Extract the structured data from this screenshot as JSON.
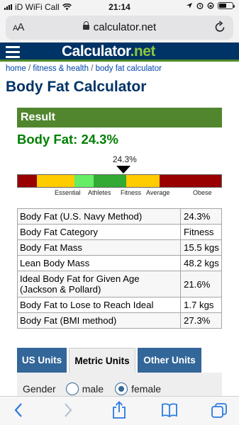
{
  "status": {
    "carrier": "iD WiFi Call",
    "time": "21:14"
  },
  "browser": {
    "aa_small": "A",
    "aa_big": "A",
    "url": "calculator.net"
  },
  "site": {
    "logo_main": "Calculator",
    "logo_dot": ".",
    "logo_tld": "net"
  },
  "breadcrumb": {
    "home": "home",
    "sep1": " / ",
    "fitness": "fitness & health",
    "sep2": " / ",
    "current": "body fat calculator"
  },
  "page_title": "Body Fat Calculator",
  "result": {
    "header": "Result",
    "headline": "Body Fat: 24.3%",
    "gauge": {
      "value_label": "24.3%",
      "value": 24.3,
      "min": 2,
      "max": 45,
      "segments": [
        {
          "label": "Essential",
          "from": 2,
          "to": 6,
          "color": "#990000"
        },
        {
          "label": "Athletes",
          "from": 6,
          "to": 14,
          "color": "#ffcc00"
        },
        {
          "label": "Fitness",
          "from": 14,
          "to": 18,
          "color": "#66ee66"
        },
        {
          "label": "Average",
          "from": 18,
          "to": 25,
          "color": "#33aa33"
        },
        {
          "label": "Obese",
          "from": 25,
          "to": 32,
          "color": "#ffcc00"
        },
        {
          "label": "",
          "from": 32,
          "to": 45,
          "color": "#990000"
        }
      ],
      "labels": [
        "Essential",
        "Athletes",
        "Fitness",
        "Average",
        "Obese"
      ]
    },
    "rows": [
      {
        "label": "Body Fat (U.S. Navy Method)",
        "value": "24.3%"
      },
      {
        "label": "Body Fat Category",
        "value": "Fitness"
      },
      {
        "label": "Body Fat Mass",
        "value": "15.5 kgs"
      },
      {
        "label": "Lean Body Mass",
        "value": "48.2 kgs"
      },
      {
        "label": "Ideal Body Fat for Given Age (Jackson & Pollard)",
        "value": "21.6%"
      },
      {
        "label": "Body Fat to Lose to Reach Ideal",
        "value": "1.7 kgs"
      },
      {
        "label": "Body Fat (BMI method)",
        "value": "27.3%"
      }
    ]
  },
  "tabs": [
    {
      "label": "US Units",
      "active": false
    },
    {
      "label": "Metric Units",
      "active": true
    },
    {
      "label": "Other Units",
      "active": false
    }
  ],
  "form": {
    "gender_label": "Gender",
    "male": "male",
    "female": "female",
    "selected": "female"
  },
  "colors": {
    "brand": "#003366",
    "accent_green": "#51862f",
    "tab_blue": "#336699",
    "result_text": "#008000"
  },
  "icons": [
    "menu-icon",
    "lock-icon",
    "reload-icon",
    "back-icon",
    "forward-icon",
    "share-icon",
    "bookmarks-icon",
    "tabs-icon"
  ]
}
